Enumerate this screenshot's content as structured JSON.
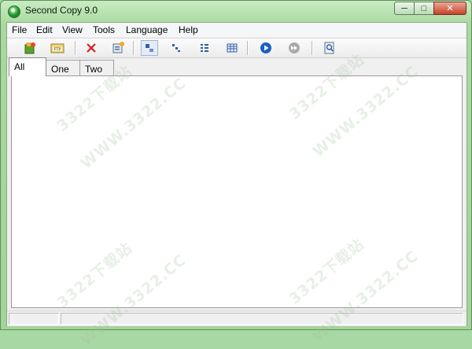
{
  "window": {
    "title": "Second Copy 9.0"
  },
  "caption_buttons": {
    "minimize": "─",
    "maximize": "□",
    "close": "✕"
  },
  "menu": [
    "File",
    "Edit",
    "View",
    "Tools",
    "Language",
    "Help"
  ],
  "toolbar": {
    "buttons": [
      {
        "name": "new-profile-icon"
      },
      {
        "name": "ftp-icon"
      },
      {
        "name": "delete-icon"
      },
      {
        "name": "properties-icon"
      },
      {
        "name": "view-large-icons-icon"
      },
      {
        "name": "view-small-icons-icon"
      },
      {
        "name": "view-list-icon"
      },
      {
        "name": "view-details-icon"
      },
      {
        "name": "run-icon"
      },
      {
        "name": "run-all-icon"
      },
      {
        "name": "find-icon"
      }
    ]
  },
  "tabs": [
    "All",
    "One",
    "Two"
  ],
  "watermark": {
    "line1": "3322下载站",
    "line2": "WWW.3322.CC"
  }
}
